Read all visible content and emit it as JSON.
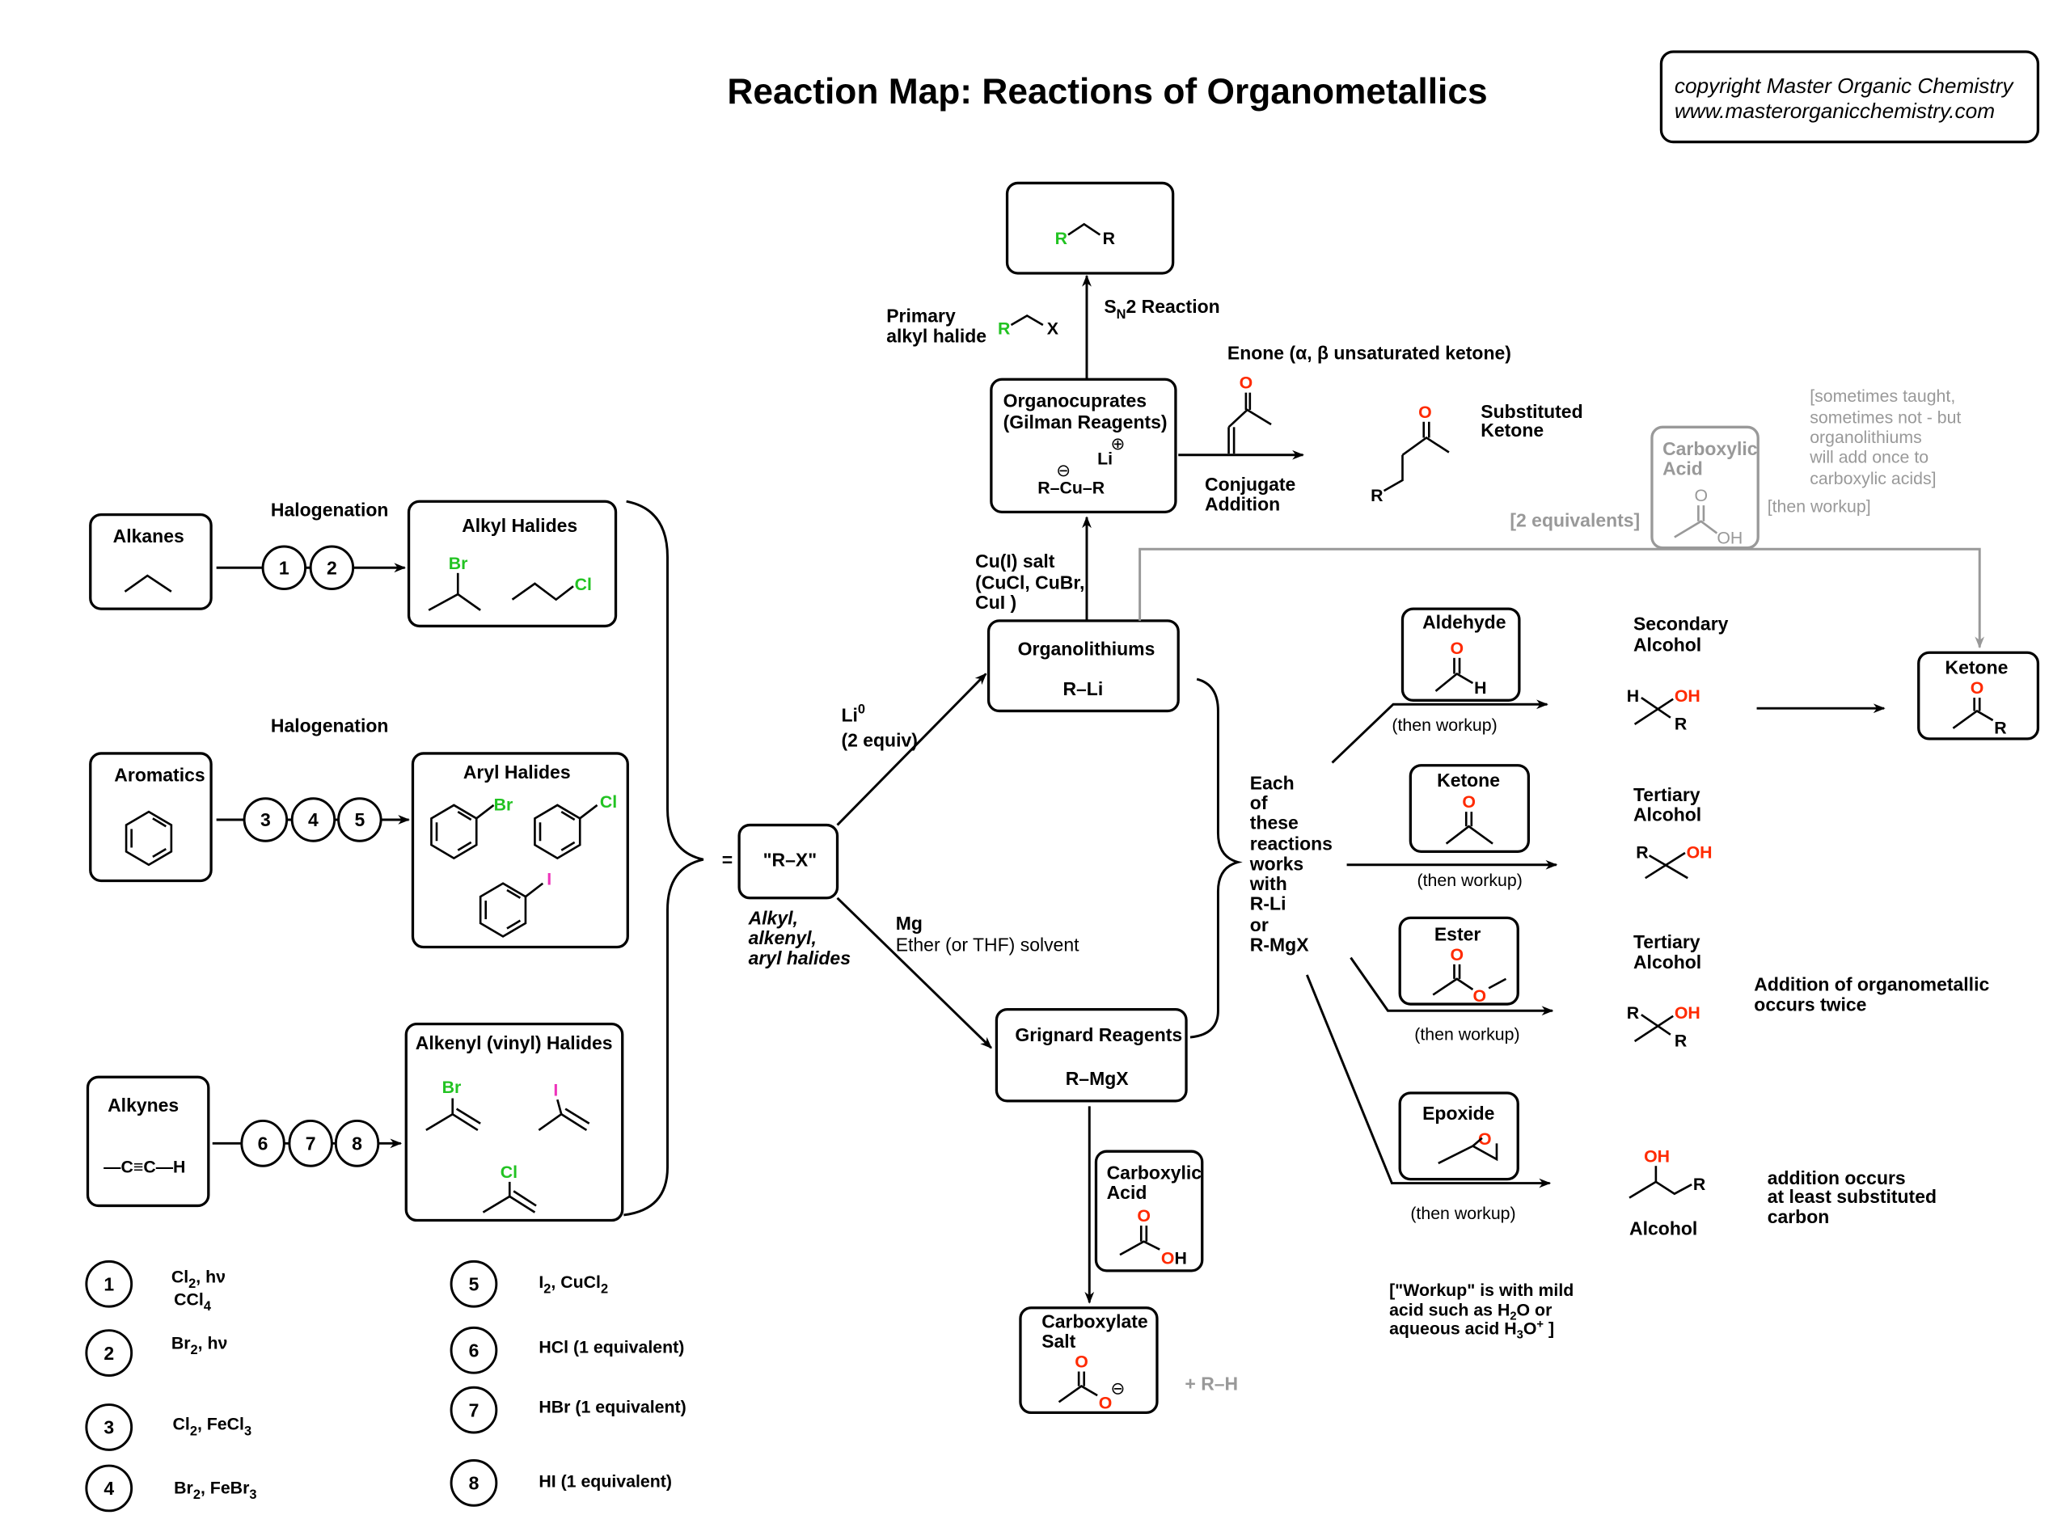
{
  "title": "Reaction Map: Reactions of Organometallics",
  "copyright": {
    "line1": "copyright Master Organic Chemistry",
    "line2": "www.masterorganicchemistry.com"
  },
  "starting_materials": {
    "alkanes": {
      "label": "Alkanes"
    },
    "aromatics": {
      "label": "Aromatics"
    },
    "alkynes": {
      "label": "Alkynes",
      "formula": "—C≡C—H"
    }
  },
  "halogenation_labels": [
    "Halogenation",
    "Halogenation"
  ],
  "halides": {
    "alkyl": {
      "label": "Alkyl Halides",
      "atoms": [
        "Br",
        "Cl"
      ]
    },
    "aryl": {
      "label": "Aryl Halides",
      "atoms": [
        "Br",
        "Cl",
        "I"
      ]
    },
    "alkenyl": {
      "label": "Alkenyl (vinyl) Halides",
      "atoms": [
        "Br",
        "I",
        "Cl"
      ]
    }
  },
  "step_numbers": {
    "alkane_route": [
      "1",
      "2"
    ],
    "aromatic_route": [
      "3",
      "4",
      "5"
    ],
    "alkyne_route": [
      "6",
      "7",
      "8"
    ]
  },
  "rx": {
    "equals": "=",
    "label": "\"R–X\"",
    "caption": [
      "Alkyl,",
      "alkenyl,",
      "aryl halides"
    ]
  },
  "li_conditions": {
    "line1": "Li",
    "sup": "0",
    "line2": "(2 equiv)"
  },
  "mg_conditions": {
    "line1": "Mg",
    "line2": "Ether (or THF) solvent"
  },
  "organolithiums": {
    "label": "Organolithiums",
    "formula": "R–Li"
  },
  "grignard": {
    "label": "Grignard Reagents",
    "formula": "R–MgX"
  },
  "cu_salt": {
    "line1": "Cu(I) salt",
    "line2": "(CuCl, CuBr,",
    "line3": "CuI )"
  },
  "organocuprates": {
    "line1": "Organocuprates",
    "line2": "(Gilman Reagents)",
    "li": "Li",
    "plus": "⊕",
    "minus": "⊖",
    "formula": "R–Cu–R"
  },
  "sn2": {
    "label_main": "S",
    "label_sub": "N",
    "label_rest": "2 Reaction",
    "reagent_line1": "Primary",
    "reagent_line2": "alkyl halide",
    "reagent_R": "R",
    "reagent_X": "X",
    "product_R1": "R",
    "product_R2": "R"
  },
  "enone": {
    "title": "Enone (α, β unsaturated ketone)",
    "O": "O",
    "arrow_line1": "Conjugate",
    "arrow_line2": "Addition",
    "product_line1": "Substituted",
    "product_line2": "Ketone",
    "product_O": "O",
    "product_R": "R"
  },
  "carboxylic_acid_side": {
    "label_line1": "Carboxylic",
    "label_line2": "Acid",
    "O": "O",
    "OH": "OH",
    "equivalents": "[2 equivalents]",
    "workup": "[then workup]",
    "note": [
      "[sometimes taught,",
      "sometimes not - but",
      "organolithiums",
      "will add once to",
      "carboxylic acids]"
    ]
  },
  "ketone_product": {
    "label": "Ketone",
    "O": "O",
    "R": "R"
  },
  "each_note": [
    "Each",
    "of",
    "these",
    "reactions",
    "works",
    "with",
    "R-Li",
    "or",
    "R-MgX"
  ],
  "electrophiles": [
    {
      "name": "Aldehyde",
      "O": "O",
      "H": "H",
      "workup": "(then workup)",
      "product_line1": "Secondary",
      "product_line2": "Alcohol",
      "product_left": "H",
      "product_OH": "OH",
      "product_R": "R"
    },
    {
      "name": "Ketone",
      "O": "O",
      "workup": "(then workup)",
      "product_line1": "Tertiary",
      "product_line2": "Alcohol",
      "product_left": "R",
      "product_OH": "OH"
    },
    {
      "name": "Ester",
      "O1": "O",
      "O2": "O",
      "workup": "(then workup)",
      "product_line1": "Tertiary",
      "product_line2": "Alcohol",
      "product_left": "R",
      "product_OH": "OH",
      "product_R": "R",
      "note_line1": "Addition of organometallic",
      "note_line2": "occurs twice"
    },
    {
      "name": "Epoxide",
      "O": "O",
      "workup": "(then workup)",
      "product_OH": "OH",
      "product_R": "R",
      "product_label": "Alcohol",
      "note": [
        "addition occurs",
        "at least substituted",
        "carbon"
      ]
    }
  ],
  "workup_note": {
    "line1": "[\"Workup\" is with mild",
    "line2a": "acid such as H",
    "line2sub": "2",
    "line2b": "O or",
    "line3a": "aqueous acid H",
    "line3sub": "3",
    "line3b": "O",
    "line3sup": "+",
    "line3c": " ]"
  },
  "grignard_acid": {
    "acid_line1": "Carboxylic",
    "acid_line2": "Acid",
    "acid_O": "O",
    "acid_O2": "O",
    "acid_H": "H",
    "salt_line1": "Carboxylate",
    "salt_line2": "Salt",
    "salt_O": "O",
    "salt_O2": "O",
    "salt_minus": "⊖",
    "byproduct": "+ R–H"
  },
  "legend": [
    {
      "num": "1",
      "parts": [
        [
          "Cl",
          "2",
          ", hν"
        ]
      ],
      "line2": [
        [
          "CCl",
          "4",
          ""
        ]
      ]
    },
    {
      "num": "2",
      "parts": [
        [
          "Br",
          "2",
          ", hν"
        ]
      ]
    },
    {
      "num": "3",
      "parts": [
        [
          "Cl",
          "2",
          ", FeCl"
        ],
        [
          "",
          "3",
          ""
        ]
      ]
    },
    {
      "num": "4",
      "parts": [
        [
          "Br",
          "2",
          ", FeBr"
        ],
        [
          "",
          "3",
          ""
        ]
      ]
    },
    {
      "num": "5",
      "parts": [
        [
          "I",
          "2",
          ", CuCl"
        ],
        [
          "",
          "2",
          ""
        ]
      ]
    },
    {
      "num": "6",
      "text": "HCl (1 equivalent)"
    },
    {
      "num": "7",
      "text": "HBr (1 equivalent)"
    },
    {
      "num": "8",
      "text": "HI (1 equivalent)"
    }
  ],
  "colors": {
    "halogen_green": "#22c322",
    "oxygen_red": "#ff2a00",
    "iodine_pink": "#ee33bb",
    "side_note_gray": "#999999"
  }
}
